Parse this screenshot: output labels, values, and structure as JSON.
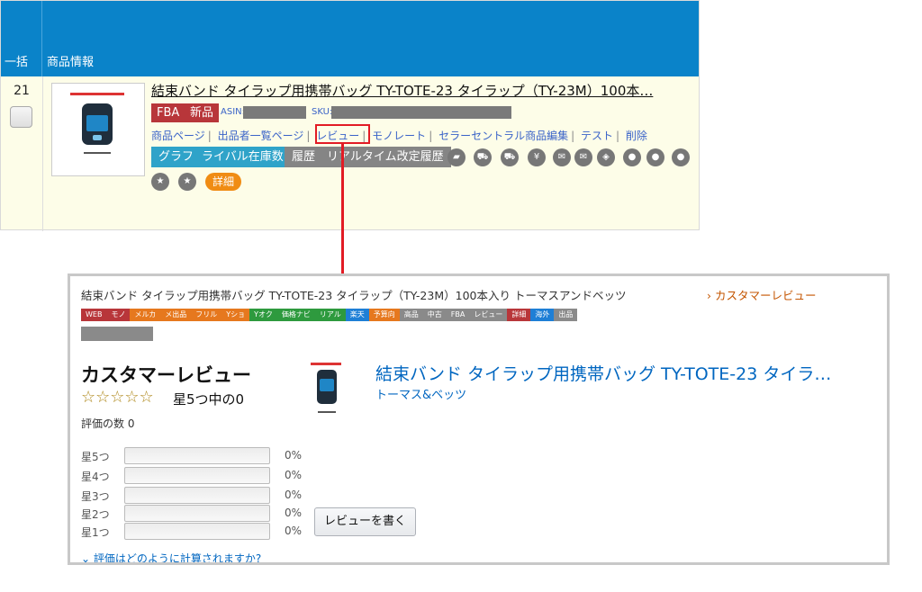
{
  "table": {
    "col_batch": "一括",
    "col_product": "商品情報",
    "row_number": "21",
    "product_title": "結束バンド タイラップ用携帯バッグ TY-TOTE-23 タイラップ（TY-23M）100本…",
    "badges": [
      "FBA",
      "新品"
    ],
    "asin_label": "ASIN:",
    "sku_label": "SKU:",
    "links": [
      "商品ページ",
      "出品者一覧ページ",
      "レビュー",
      "モノレート",
      "セラーセントラル商品編集",
      "テスト",
      "削除"
    ],
    "buttons": [
      {
        "label": "グラフ",
        "color": "#2fa3c9"
      },
      {
        "label": "ライバル在庫数",
        "color": "#2fa3c9"
      },
      {
        "label": "履歴",
        "color": "#858585"
      },
      {
        "label": "リアルタイム改定履歴",
        "color": "#858585"
      }
    ],
    "icons": [
      "folder-icon",
      "cart-icon",
      "cart-icon",
      "yen-icon",
      "mail-icon",
      "mail-open-icon",
      "tag-icon",
      "user-icon",
      "users-icon",
      "group-icon",
      "star-icon",
      "star-icon"
    ],
    "detail_label": "詳細"
  },
  "panel": {
    "product_title": "結束バンド タイラップ用携帯バッグ TY-TOTE-23 タイラップ（TY-23M）100本入り トーマスアンドベッツ",
    "breadcrumb": "› カスタマーレビュー",
    "tabs": [
      {
        "label": "WEB",
        "color": "#b8363a"
      },
      {
        "label": "モノ",
        "color": "#b8363a"
      },
      {
        "label": "メルカ",
        "color": "#e6781e"
      },
      {
        "label": "メ出品",
        "color": "#e6781e"
      },
      {
        "label": "フリル",
        "color": "#e6781e"
      },
      {
        "label": "Yショ",
        "color": "#e6781e"
      },
      {
        "label": "Yオク",
        "color": "#2e9a3e"
      },
      {
        "label": "価格ナビ",
        "color": "#2e9a3e"
      },
      {
        "label": "リアル",
        "color": "#2e9a3e"
      },
      {
        "label": "楽天",
        "color": "#1e7fd6"
      },
      {
        "label": "予算向",
        "color": "#e6781e"
      },
      {
        "label": "高品",
        "color": "#8a8a8a"
      },
      {
        "label": "中古",
        "color": "#8a8a8a"
      },
      {
        "label": "FBA",
        "color": "#8a8a8a"
      },
      {
        "label": "レビュー",
        "color": "#8a8a8a"
      },
      {
        "label": "詳細",
        "color": "#b8363a"
      },
      {
        "label": "海外",
        "color": "#1e7fd6"
      },
      {
        "label": "出品",
        "color": "#8a8a8a"
      }
    ],
    "reviews_heading": "カスタマーレビュー",
    "stars_display": "☆☆☆☆☆",
    "rating_text": "星5つ中の0",
    "rating_count": "評価の数 0",
    "rating_rows": [
      {
        "label": "星5つ",
        "percent": "0%"
      },
      {
        "label": "星4つ",
        "percent": "0%"
      },
      {
        "label": "星3つ",
        "percent": "0%"
      },
      {
        "label": "星2つ",
        "percent": "0%"
      },
      {
        "label": "星1つ",
        "percent": "0%"
      }
    ],
    "write_review_label": "レビューを書く",
    "how_calculated": "⌄ 評価はどのように計算されますか?",
    "product_name": "結束バンド タイラップ用携帯バッグ TY-TOTE-23 タイラ…",
    "brand": "トーマス&ベッツ"
  },
  "colors": {
    "header_blue": "#0a83c9",
    "highlight_red": "#e21b24",
    "link_blue": "#3a63c8",
    "amazon_link": "#0066c0",
    "row_bg": "#fdfde8"
  }
}
